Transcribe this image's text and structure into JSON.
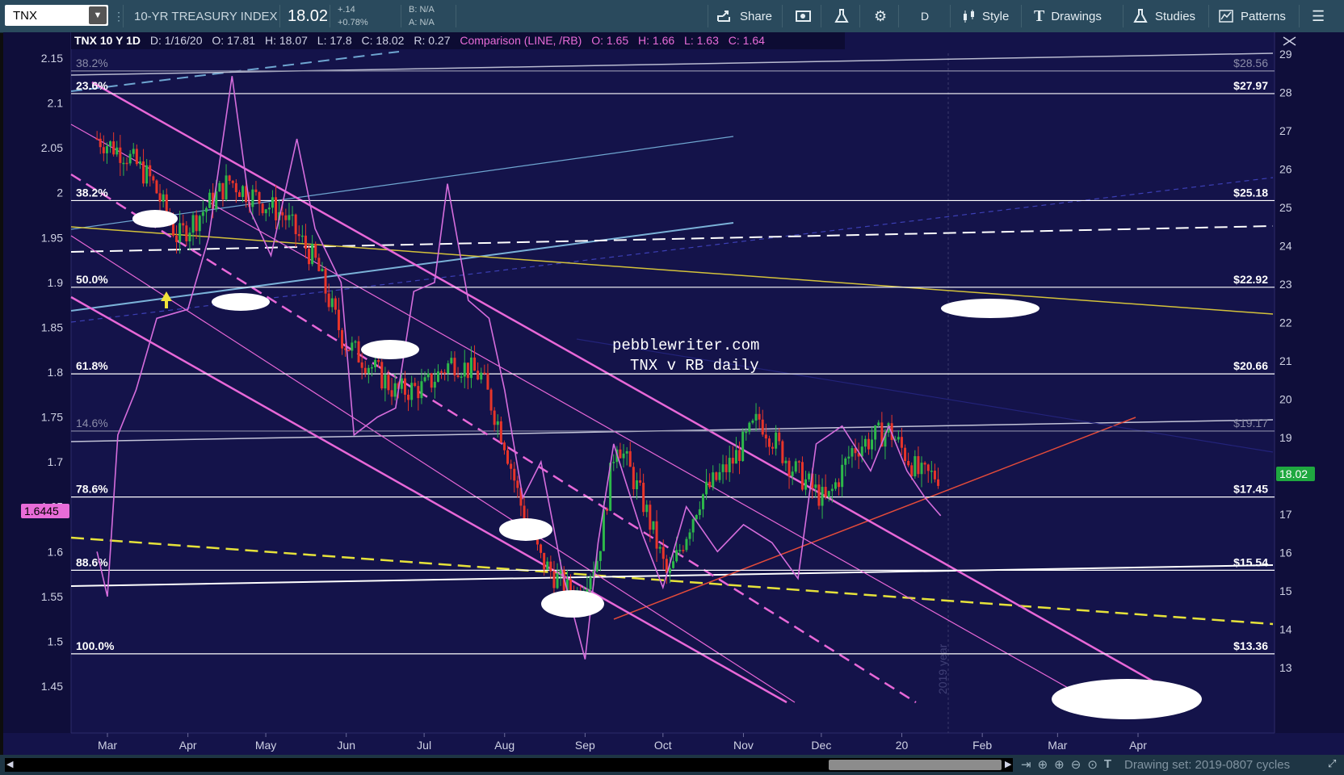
{
  "toolbar": {
    "symbol": "TNX",
    "description": "10-YR TREASURY INDEX",
    "price": "18.02",
    "change": "+.14",
    "change_pct": "+0.78%",
    "bid": "B: N/A",
    "ask": "A: N/A",
    "share": "Share",
    "interval": "D",
    "style": "Style",
    "drawings": "Drawings",
    "studies": "Studies",
    "patterns": "Patterns"
  },
  "legend": {
    "title": "TNX 10 Y 1D",
    "date": "D: 1/16/20",
    "open": "O: 17.81",
    "high": "H: 18.07",
    "low": "L: 17.8",
    "close": "C: 18.02",
    "range": "R: 0.27",
    "comparison": "Comparison (LINE, /RB)",
    "cmp_open": "O: 1.65",
    "cmp_high": "H: 1.66",
    "cmp_low": "L: 1.63",
    "cmp_close": "C: 1.64"
  },
  "watermark": {
    "line1": "pebblewriter.com",
    "line2": "TNX v RB daily",
    "vertical_label": "2019 year"
  },
  "badges": {
    "price": "18.02",
    "comparison": "1.6445"
  },
  "statusbar": {
    "drawing_set": "Drawing set: 2019-0807 cycles"
  },
  "colors": {
    "background": "#14134a",
    "up": "#2db84a",
    "down": "#e8352a",
    "comparison": "#d56ddc",
    "channel": "#e868d8",
    "badge_green": "#1fa840",
    "badge_pink": "#e86cd8"
  },
  "chart_data": {
    "type": "line",
    "x_ticks": [
      "Mar",
      "Apr",
      "May",
      "Jun",
      "Jul",
      "Aug",
      "Sep",
      "Oct",
      "Nov",
      "Dec",
      "20",
      "Feb",
      "Mar",
      "Apr"
    ],
    "y_left_ticks": [
      "2.15",
      "2.1",
      "2.05",
      "2",
      "1.95",
      "1.9",
      "1.85",
      "1.8",
      "1.75",
      "1.7",
      "1.65",
      "1.6",
      "1.55",
      "1.5",
      "1.45"
    ],
    "y_right_ticks": [
      "29",
      "28",
      "27",
      "26",
      "25",
      "24",
      "23",
      "22",
      "21",
      "20",
      "19",
      "18",
      "17",
      "16",
      "15",
      "14",
      "13"
    ],
    "y_left_range": [
      1.43,
      2.18
    ],
    "y_right_range": [
      12.5,
      29.2
    ],
    "fib_levels": [
      {
        "label": "38.2%",
        "value": 28.56,
        "value_label": "$28.56",
        "dim": true
      },
      {
        "label": "23.6%",
        "value": 27.97,
        "value_label": "$27.97",
        "dim": false
      },
      {
        "label": "38.2%",
        "value": 25.18,
        "value_label": "$25.18",
        "dim": false
      },
      {
        "label": "50.0%",
        "value": 22.92,
        "value_label": "$22.92",
        "dim": false
      },
      {
        "label": "61.8%",
        "value": 20.66,
        "value_label": "$20.66",
        "dim": false
      },
      {
        "label": "14.6%",
        "value": 19.17,
        "value_label": "$19.17",
        "dim": true
      },
      {
        "label": "78.6%",
        "value": 17.45,
        "value_label": "$17.45",
        "dim": false
      },
      {
        "label": "88.6%",
        "value": 15.54,
        "value_label": "$15.54",
        "dim": false
      },
      {
        "label": "100.0%",
        "value": 13.36,
        "value_label": "$13.36",
        "dim": false
      }
    ],
    "series": [
      {
        "name": "TNX",
        "axis": "right",
        "x": [
          "2019-02-25",
          "2019-03-08",
          "2019-03-18",
          "2019-03-28",
          "2019-04-08",
          "2019-04-17",
          "2019-04-26",
          "2019-05-08",
          "2019-05-20",
          "2019-05-31",
          "2019-06-10",
          "2019-06-20",
          "2019-07-01",
          "2019-07-12",
          "2019-07-23",
          "2019-08-01",
          "2019-08-07",
          "2019-08-15",
          "2019-08-28",
          "2019-09-06",
          "2019-09-13",
          "2019-09-24",
          "2019-10-03",
          "2019-10-15",
          "2019-10-28",
          "2019-11-07",
          "2019-11-20",
          "2019-12-03",
          "2019-12-13",
          "2019-12-27",
          "2020-01-08",
          "2020-01-16"
        ],
        "values": [
          26.8,
          26.4,
          25.7,
          24.2,
          25.0,
          25.7,
          25.3,
          24.8,
          23.6,
          21.5,
          20.9,
          20.2,
          20.3,
          21.0,
          20.6,
          18.9,
          17.3,
          15.8,
          14.8,
          15.9,
          19.0,
          17.2,
          15.3,
          17.4,
          18.4,
          19.5,
          18.2,
          17.3,
          18.7,
          19.2,
          18.0,
          18.02
        ]
      },
      {
        "name": "/RB",
        "axis": "left",
        "x": [
          "2019-02-25",
          "2019-03-01",
          "2019-03-05",
          "2019-03-12",
          "2019-03-20",
          "2019-04-01",
          "2019-04-09",
          "2019-04-18",
          "2019-04-25",
          "2019-05-03",
          "2019-05-13",
          "2019-05-20",
          "2019-05-30",
          "2019-06-04",
          "2019-06-13",
          "2019-06-20",
          "2019-06-27",
          "2019-07-05",
          "2019-07-10",
          "2019-07-18",
          "2019-07-26",
          "2019-08-01",
          "2019-08-08",
          "2019-08-15",
          "2019-08-23",
          "2019-09-01",
          "2019-09-06",
          "2019-09-12",
          "2019-09-23",
          "2019-10-01",
          "2019-10-10",
          "2019-10-22",
          "2019-11-01",
          "2019-11-12",
          "2019-11-22",
          "2019-11-29",
          "2019-12-09",
          "2019-12-20",
          "2019-12-27",
          "2020-01-03",
          "2020-01-10",
          "2020-01-16"
        ],
        "values": [
          1.6,
          1.55,
          1.73,
          1.78,
          1.86,
          1.87,
          1.95,
          2.13,
          1.98,
          1.93,
          2.06,
          1.96,
          1.9,
          1.73,
          1.75,
          1.76,
          1.89,
          1.9,
          2.01,
          1.88,
          1.86,
          1.78,
          1.66,
          1.7,
          1.58,
          1.48,
          1.61,
          1.72,
          1.62,
          1.56,
          1.65,
          1.6,
          1.63,
          1.61,
          1.57,
          1.72,
          1.74,
          1.69,
          1.74,
          1.69,
          1.66,
          1.64
        ]
      }
    ]
  }
}
